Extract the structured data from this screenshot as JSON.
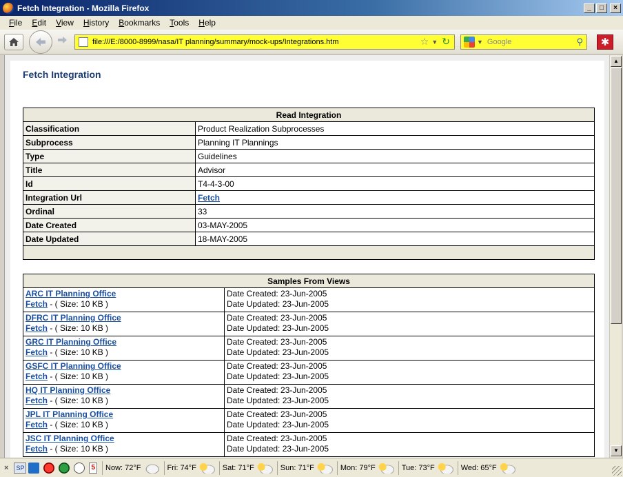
{
  "window": {
    "title": "Fetch Integration - Mozilla Firefox",
    "controls": {
      "minimize": "_",
      "maximize": "□",
      "close": "×"
    }
  },
  "menu": [
    {
      "label": "File",
      "access": "F",
      "rest": "ile"
    },
    {
      "label": "Edit",
      "access": "E",
      "rest": "dit"
    },
    {
      "label": "View",
      "access": "V",
      "rest": "iew"
    },
    {
      "label": "History",
      "access": "H",
      "rest": "istory"
    },
    {
      "label": "Bookmarks",
      "access": "B",
      "rest": "ookmarks"
    },
    {
      "label": "Tools",
      "access": "T",
      "rest": "ools"
    },
    {
      "label": "Help",
      "access": "H",
      "rest": "elp"
    }
  ],
  "toolbar": {
    "home_icon": "home-icon",
    "back_icon": "back-arrow-icon",
    "forward_icon": "forward-arrow-icon",
    "url": "file:///E:/8000-8999/nasa/IT planning/summary/mock-ups/Integrations.htm",
    "search_placeholder": "Google",
    "url_bg": "#ffff33"
  },
  "page": {
    "title": "Fetch Integration",
    "read_integration": {
      "header": "Read Integration",
      "rows": [
        {
          "key": "Classification",
          "value": "Product Realization Subprocesses",
          "is_link": false
        },
        {
          "key": "Subprocess",
          "value": "Planning IT Plannings",
          "is_link": false
        },
        {
          "key": "Type",
          "value": "Guidelines",
          "is_link": false
        },
        {
          "key": "Title",
          "value": "Advisor",
          "is_link": false
        },
        {
          "key": "Id",
          "value": "T4-4-3-00",
          "is_link": false
        },
        {
          "key": "Integration Url",
          "value": "Fetch",
          "is_link": true
        },
        {
          "key": "Ordinal",
          "value": "33",
          "is_link": false
        },
        {
          "key": "Date Created",
          "value": "03-MAY-2005",
          "is_link": false
        },
        {
          "key": "Date Updated",
          "value": "18-MAY-2005",
          "is_link": false
        }
      ]
    },
    "samples": {
      "header": "Samples From Views",
      "rows": [
        {
          "office": "ARC IT Planning Office",
          "fetch": "Fetch",
          "size": " - ( Size: 10 KB )",
          "created": "Date Created: 23-Jun-2005",
          "updated": "Date Updated: 23-Jun-2005"
        },
        {
          "office": "DFRC IT Planning Office",
          "fetch": "Fetch",
          "size": " - ( Size: 10 KB )",
          "created": "Date Created: 23-Jun-2005",
          "updated": "Date Updated: 23-Jun-2005"
        },
        {
          "office": "GRC IT Planning Office",
          "fetch": "Fetch",
          "size": " - ( Size: 10 KB )",
          "created": "Date Created: 23-Jun-2005",
          "updated": "Date Updated: 23-Jun-2005"
        },
        {
          "office": "GSFC IT Planning Office ",
          "fetch": "Fetch",
          "size": " - ( Size: 10 KB )",
          "created": "Date Created: 23-Jun-2005",
          "updated": "Date Updated: 23-Jun-2005"
        },
        {
          "office": "HQ IT Planning Office ",
          "fetch": "Fetch",
          "size": " - ( Size: 10 KB )",
          "created": "Date Created: 23-Jun-2005",
          "updated": "Date Updated: 23-Jun-2005"
        },
        {
          "office": "JPL IT Planning Office ",
          "fetch": "Fetch",
          "size": " - ( Size: 10 KB )",
          "created": "Date Created: 23-Jun-2005",
          "updated": "Date Updated: 23-Jun-2005"
        },
        {
          "office": "JSC IT Planning Office ",
          "fetch": "Fetch",
          "size": " - ( Size: 10 KB )",
          "created": "Date Created: 23-Jun-2005",
          "updated": "Date Updated: 23-Jun-2005"
        }
      ]
    },
    "link_color": "#1a4fa0",
    "title_color": "#1a3c73",
    "header_bg": "#ebe9dc"
  },
  "statusbar": {
    "close_label": "×",
    "sp_label": "SP",
    "calendar_day": "5",
    "weather": [
      {
        "label": "Now: 72°F",
        "icon": "cloud-icon"
      },
      {
        "label": "Fri: 74°F",
        "icon": "thunderstorm-icon"
      },
      {
        "label": "Sat: 71°F",
        "icon": "partly-cloudy-icon"
      },
      {
        "label": "Sun: 71°F",
        "icon": "partly-cloudy-icon"
      },
      {
        "label": "Mon: 79°F",
        "icon": "partly-cloudy-icon"
      },
      {
        "label": "Tue: 73°F",
        "icon": "partly-cloudy-icon"
      },
      {
        "label": "Wed: 65°F",
        "icon": "partly-cloudy-icon"
      }
    ]
  }
}
